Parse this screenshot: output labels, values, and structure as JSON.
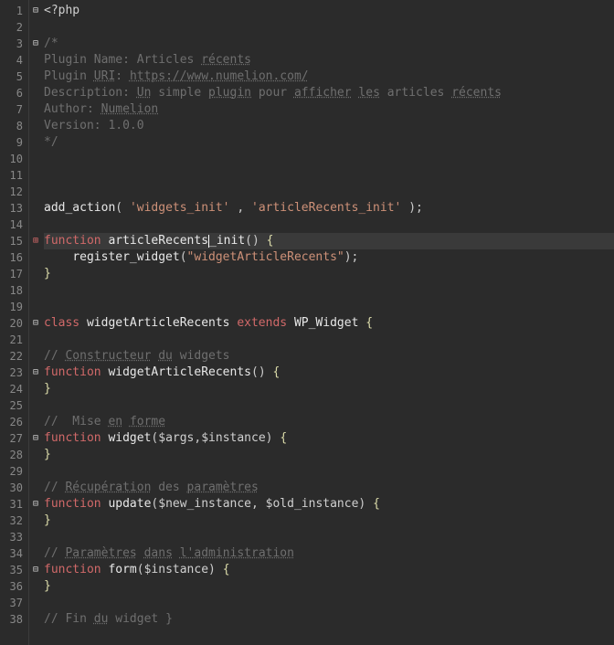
{
  "editor": {
    "line_count": 38,
    "current_line": 15,
    "fold_markers": {
      "1": "minus",
      "3": "minus",
      "15": "plus",
      "20": "minus",
      "23": "minus",
      "27": "minus",
      "31": "minus",
      "35": "minus"
    }
  },
  "code": {
    "l1_open": "<?php",
    "l3_c": "/*",
    "l4_a": "Plugin Name: Articles ",
    "l4_b": "récents",
    "l5_a": "Plugin ",
    "l5_b": "URI",
    "l5_c": ": ",
    "l5_d": "https://www.numelion.com/",
    "l6_a": "Description: ",
    "l6_b": "Un",
    "l6_c": " simple ",
    "l6_d": "plugin",
    "l6_e": " pour ",
    "l6_f": "afficher",
    "l6_g": " ",
    "l6_h": "les",
    "l6_i": " articles ",
    "l6_j": "récents",
    "l7_a": "Author: ",
    "l7_b": "Numelion",
    "l8": "Version: 1.0.0",
    "l9": "*/",
    "l13_fn": "add_action",
    "l13_s1": "'widgets_init'",
    "l13_s2": "'articleRecents_init'",
    "l15_kw": "function",
    "l15_name": " articleRecents",
    "l15_suffix": "_init",
    "l16_fn": "register_widget",
    "l16_s": "\"widgetArticleRecents\"",
    "l20_kw1": "class",
    "l20_cls": " widgetArticleRecents ",
    "l20_kw2": "extends",
    "l20_ext": " WP_Widget ",
    "l22_a": "// ",
    "l22_b": "Constructeur",
    "l22_c": " ",
    "l22_d": "du",
    "l22_e": " widgets",
    "l23_kw": "function",
    "l23_name": " widgetArticleRecents",
    "l26_a": "//  Mise ",
    "l26_b": "en",
    "l26_c": " ",
    "l26_d": "forme",
    "l27_kw": "function",
    "l27_name": " widget",
    "l27_v1": "$args",
    "l27_v2": "$instance",
    "l30_a": "// ",
    "l30_b": "Récupération",
    "l30_c": " des ",
    "l30_d": "paramètres",
    "l31_kw": "function",
    "l31_name": " update",
    "l31_v1": "$new_instance",
    "l31_v2": "$old_instance",
    "l34_a": "// ",
    "l34_b": "Paramètres",
    "l34_c": " ",
    "l34_d": "dans",
    "l34_e": " ",
    "l34_f": "l'administration",
    "l35_kw": "function",
    "l35_name": " form",
    "l35_v1": "$instance",
    "l38_a": "// Fin ",
    "l38_b": "du",
    "l38_c": " widget }"
  }
}
